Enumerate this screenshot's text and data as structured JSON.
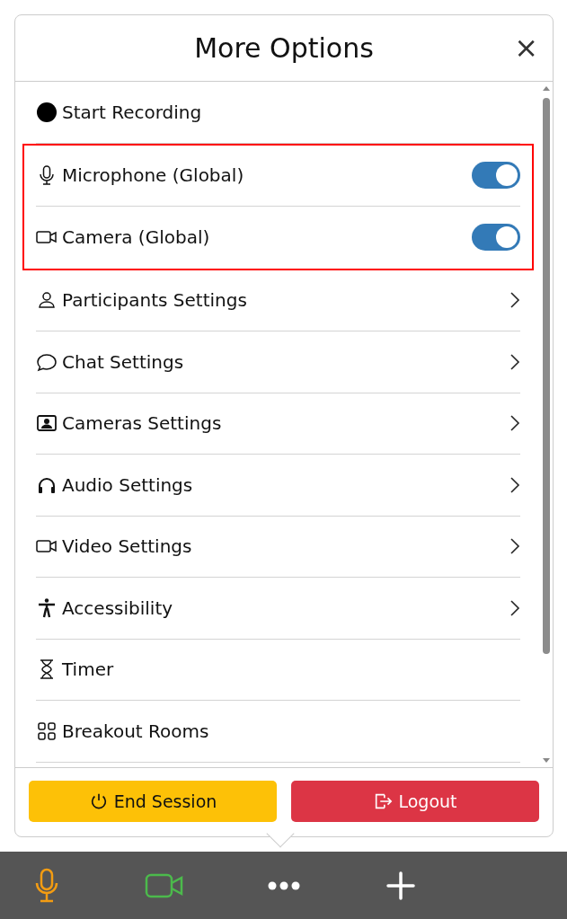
{
  "dialog": {
    "title": "More Options",
    "close": "×"
  },
  "items": [
    {
      "kind": "action",
      "label": "Start Recording",
      "highlighted": false
    },
    {
      "kind": "toggle",
      "label": "Microphone (Global)",
      "on": true,
      "highlighted": true
    },
    {
      "kind": "toggle",
      "label": "Camera (Global)",
      "on": true,
      "highlighted": true
    },
    {
      "kind": "submenu",
      "label": "Participants Settings",
      "highlighted": false
    },
    {
      "kind": "submenu",
      "label": "Chat Settings",
      "highlighted": false
    },
    {
      "kind": "submenu",
      "label": "Cameras Settings",
      "highlighted": false
    },
    {
      "kind": "submenu",
      "label": "Audio Settings",
      "highlighted": false
    },
    {
      "kind": "submenu",
      "label": "Video Settings",
      "highlighted": false
    },
    {
      "kind": "submenu",
      "label": "Accessibility",
      "highlighted": false
    },
    {
      "kind": "action",
      "label": "Timer",
      "highlighted": false
    },
    {
      "kind": "action",
      "label": "Breakout Rooms",
      "highlighted": false
    }
  ],
  "footer_buttons": [
    {
      "kind": "warning",
      "label": "End Session"
    },
    {
      "kind": "danger",
      "label": "Logout"
    }
  ]
}
